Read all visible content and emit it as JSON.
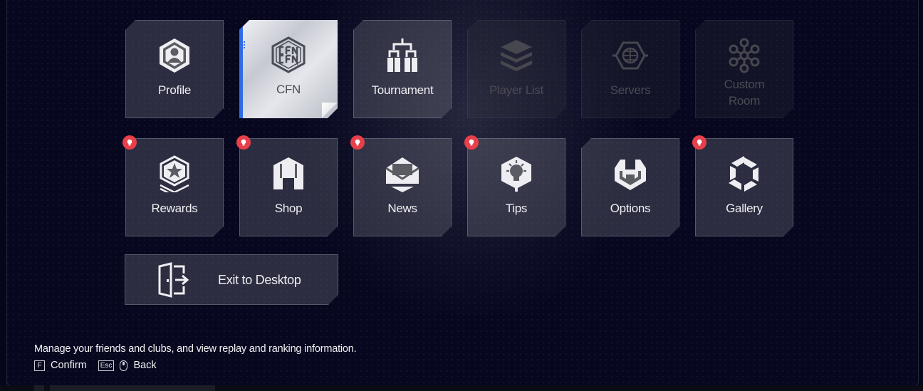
{
  "menu": {
    "row1": [
      {
        "id": "profile",
        "label": "Profile",
        "icon": "profile-hexagon-icon",
        "state": "normal"
      },
      {
        "id": "cfn",
        "label": "CFN",
        "icon": "cfn-logo-icon",
        "state": "selected"
      },
      {
        "id": "tournament",
        "label": "Tournament",
        "icon": "tournament-bracket-icon",
        "state": "normal"
      },
      {
        "id": "player-list",
        "label": "Player List",
        "icon": "stack-layers-icon",
        "state": "disabled"
      },
      {
        "id": "servers",
        "label": "Servers",
        "icon": "globe-server-icon",
        "state": "disabled"
      },
      {
        "id": "custom-room",
        "label": "Custom Room",
        "label_line1": "Custom",
        "label_line2": "Room",
        "icon": "hex-network-icon",
        "state": "disabled"
      }
    ],
    "row2": [
      {
        "id": "rewards",
        "label": "Rewards",
        "icon": "star-badge-icon",
        "state": "normal",
        "notification": true
      },
      {
        "id": "shop",
        "label": "Shop",
        "icon": "shop-house-icon",
        "state": "normal",
        "notification": true
      },
      {
        "id": "news",
        "label": "News",
        "icon": "envelope-icon",
        "state": "normal",
        "notification": true
      },
      {
        "id": "tips",
        "label": "Tips",
        "icon": "lightbulb-icon",
        "state": "normal",
        "notification": true
      },
      {
        "id": "options",
        "label": "Options",
        "icon": "wrench-icon",
        "state": "normal",
        "notification": false
      },
      {
        "id": "gallery",
        "label": "Gallery",
        "icon": "aperture-icon",
        "state": "normal",
        "notification": true
      }
    ],
    "exit": {
      "label": "Exit to Desktop",
      "icon": "exit-door-icon"
    }
  },
  "footer": {
    "description": "Manage your friends and clubs, and view replay and ranking information.",
    "hints": [
      {
        "key": "F",
        "label": "Confirm"
      },
      {
        "key": "Esc",
        "label": "Back",
        "mouse": true
      }
    ]
  },
  "colors": {
    "background": "#070820",
    "tile": "#5a5a62",
    "selected_tile": "#d9dae0",
    "accent": "#2e6be6",
    "notification": "#e8404a"
  }
}
